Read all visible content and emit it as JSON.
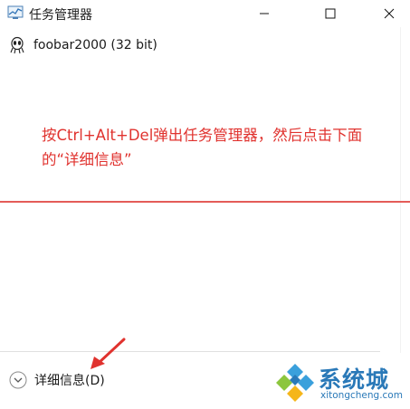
{
  "window": {
    "title": "任务管理器"
  },
  "process": {
    "name": "foobar2000 (32 bit)"
  },
  "annotation": {
    "text": "按Ctrl+Alt+Del弹出任务管理器，然后点击下面的“详细信息”"
  },
  "footer": {
    "details_label": "详细信息(D)"
  },
  "watermark": {
    "name": "系统城",
    "domain": "xitongcheng.com"
  },
  "colors": {
    "annotation": "#e0322e",
    "watermark": "#2a79b8"
  }
}
